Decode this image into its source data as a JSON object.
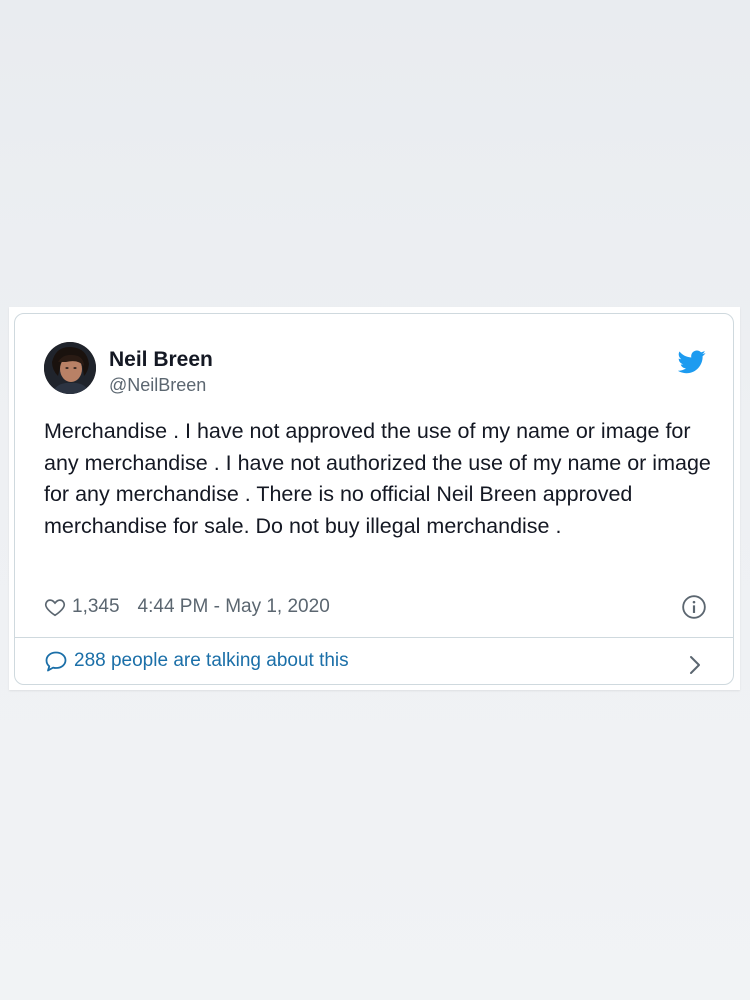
{
  "tweet": {
    "author": {
      "display_name": "Neil Breen",
      "handle": "@NeilBreen",
      "avatar_icon": "user-avatar"
    },
    "platform_icon": "twitter-bird-icon",
    "text": "Merchandise . I have not approved the use of my name or image for any merchandise . I have not authorized the use of my name or image for any merchandise . There is no official Neil Breen approved merchandise for sale. Do not buy illegal merchandise .",
    "likes": "1,345",
    "timestamp": "4:44 PM - May 1, 2020",
    "conversation_link": "288 people are talking about this"
  },
  "colors": {
    "twitter_blue": "#1d9bf0",
    "link_blue": "#1b6fa8",
    "text_primary": "#141823",
    "text_secondary": "#5b6670",
    "border": "#cfd9de"
  }
}
